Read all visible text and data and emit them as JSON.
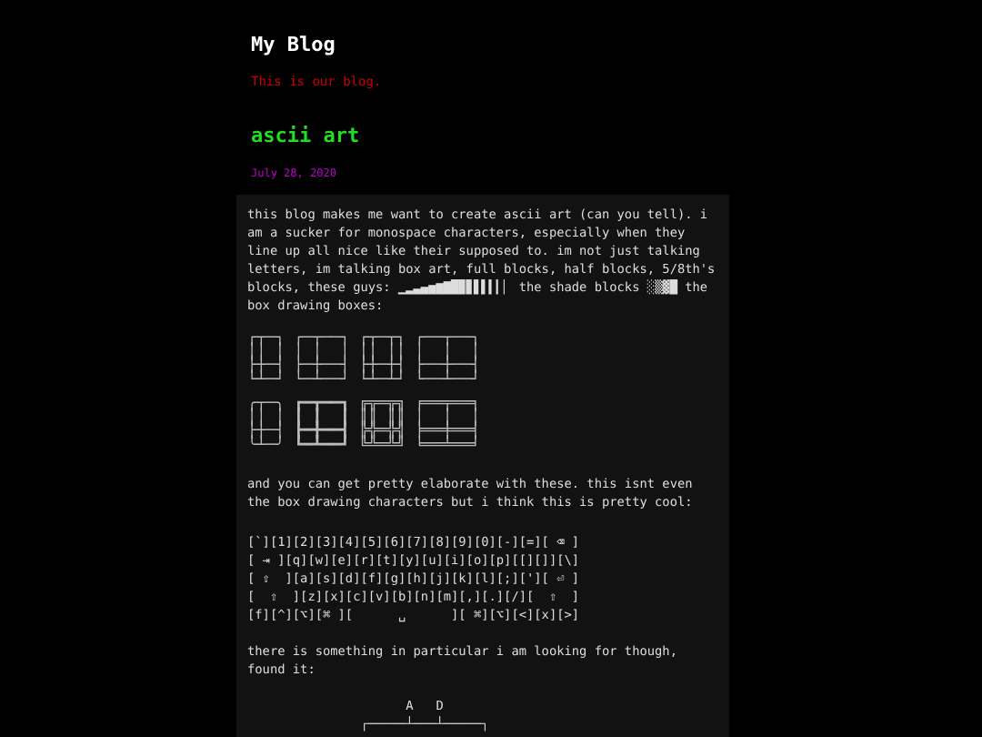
{
  "blog": {
    "title": "My Blog",
    "tagline": "This is our blog."
  },
  "post": {
    "title": "ascii art",
    "date": "July 28, 2020",
    "intro": "this blog makes me want to create ascii art (can you tell). i am a sucker for monospace characters, especially when they line up all nice like their supposed to. im not just talking letters, im talking box art, full blocks, half blocks, 5/8th's blocks, these guys: ▁▂▃▄▅▆▇█▉▊▋▌▍▎▏ the shade blocks  ░▒▓█ the box drawing boxes:",
    "box_art": [
      [
        "┌┬─┐ ┌─┬──┐ ┌┬─┬┐ ┌──┬──┐",
        "││ │ │ │  │ ││ ││ │  │  │",
        "├┼─┤ ├─┼──┤ ├┼─┼┤ ├──┼──┤",
        "└┴─┘ └─┴──┘ └┴─┴┘ └──┴──┘"
      ],
      [
        "╭┬─╮ ┏━┳━━┓ ╔╦═╦╗ ╒══╤══╕",
        "││ │ ┃ ┃  ┃ ║║ ║║ │  │  │",
        "├┼─┤ ┣━╋━━┫ ╠╬═╬╣ ╞══╪══╡",
        "╰┴─╯ ┗━┻━━┛ ╚╩═╩╝ ╘══╧══╛"
      ]
    ],
    "middle": "and you can get pretty elaborate with these. this isnt even the box drawing characters but i think this is pretty cool:",
    "keyboard": [
      "[`][1][2][3][4][5][6][7][8][9][0][-][=][ ⌫ ]",
      "[ ⇥ ][q][w][e][r][t][y][u][i][o][p][[][]][\\]",
      "[ ⇪  ][a][s][d][f][g][h][j][k][l][;]['][ ⏎ ]",
      "[  ⇧  ][z][x][c][v][b][n][m][,][.][/][  ⇧  ]",
      "[f][^][⌥][⌘ ][      ␣      ][ ⌘][⌥][<][x][>]"
    ],
    "closing": "there is something in particular i am looking for though, found it:",
    "diagram": [
      "                     A   D",
      "               ┌─────┴───┴─────┐"
    ]
  }
}
